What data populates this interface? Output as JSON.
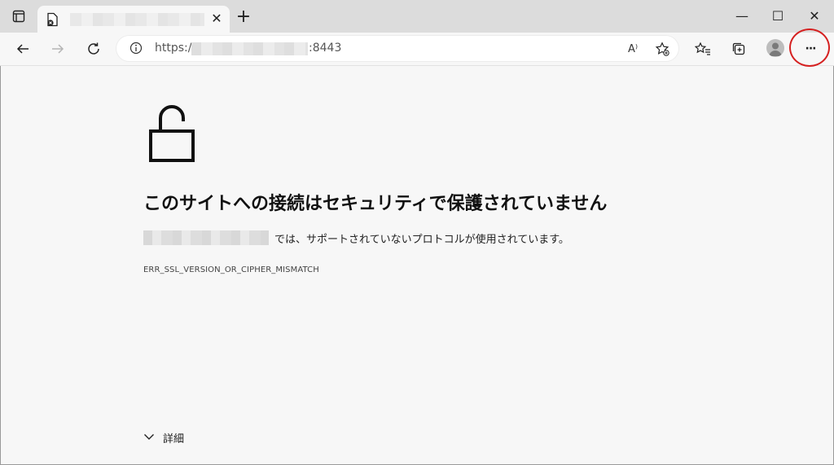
{
  "tab": {
    "close_glyph": "✕",
    "new_tab_glyph": "+"
  },
  "window_controls": {
    "minimize": "—",
    "maximize": "☐",
    "close": "✕"
  },
  "address": {
    "scheme": "https://",
    "port": ":8443"
  },
  "toolbar": {
    "read_aloud_label": "A⁾",
    "more_glyph": "···"
  },
  "error_page": {
    "heading": "このサイトへの接続はセキュリティで保護されていません",
    "description": "では、サポートされていないプロトコルが使用されています。",
    "error_code": "ERR_SSL_VERSION_OR_CIPHER_MISMATCH",
    "details_label": "詳細"
  },
  "icons": [
    "tab-actions-icon",
    "favicon-error-icon",
    "back-icon",
    "forward-icon",
    "refresh-icon",
    "info-icon",
    "read-aloud-icon",
    "add-favorite-icon",
    "favorites-icon",
    "collections-icon",
    "profile-icon",
    "more-icon",
    "unlocked-padlock-icon",
    "chevron-down-icon"
  ],
  "colors": {
    "highlight_circle": "#d52020"
  }
}
